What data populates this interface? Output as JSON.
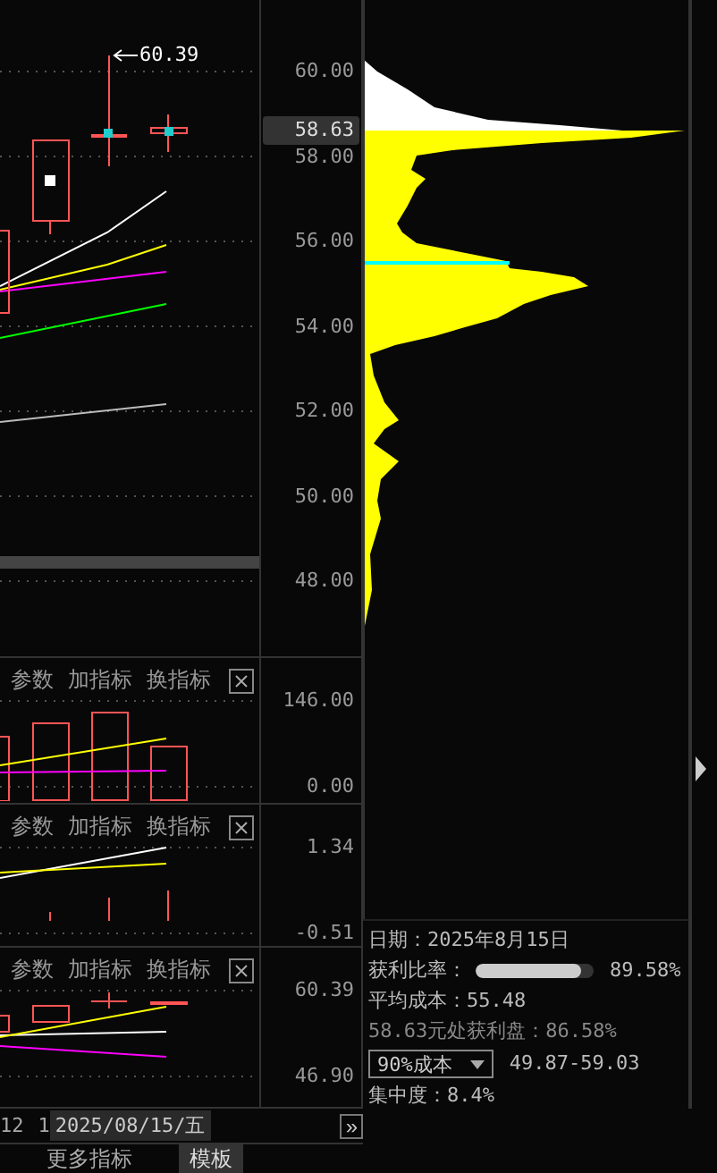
{
  "price_panel": {
    "axis_labels": [
      "60.00",
      "58.00",
      "56.00",
      "54.00",
      "52.00",
      "50.00",
      "48.00"
    ],
    "current_price": "58.63",
    "high_marker": "60.39"
  },
  "indicator_panels": [
    {
      "buttons": [
        "参数",
        "加指标",
        "换指标"
      ],
      "axis_labels": [
        "146.00",
        "0.00"
      ]
    },
    {
      "buttons": [
        "参数",
        "加指标",
        "换指标"
      ],
      "axis_labels": [
        "1.34",
        "-0.51"
      ]
    },
    {
      "buttons": [
        "参数",
        "加指标",
        "换指标"
      ],
      "axis_labels": [
        "60.39",
        "46.90"
      ]
    }
  ],
  "time_axis": {
    "labels": [
      "12",
      "1"
    ],
    "cursor_date": "2025/08/15/五",
    "expand": "»"
  },
  "bottom_tabs": [
    {
      "label": "更多指标",
      "selected": false
    },
    {
      "label": "模板",
      "selected": true
    }
  ],
  "chip_info": {
    "date": "日期：2025年8月15日",
    "profit_ratio_label": "获利比率：",
    "profit_ratio": {
      "level": 0.8958
    },
    "profit_ratio_value": "89.58%",
    "avg_cost": "平均成本：55.48",
    "profit_at_price": "58.63元处获利盘：86.58%",
    "cost_range": {
      "selected": "90%成本",
      "value": "49.87-59.03"
    },
    "concentration": "集中度：8.4%"
  }
}
